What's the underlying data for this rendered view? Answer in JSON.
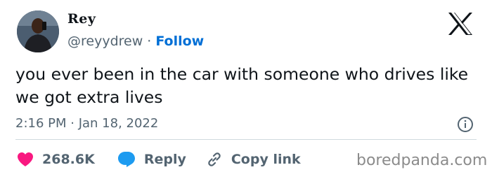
{
  "author": {
    "display_name": "Rey",
    "handle": "@reyydrew",
    "separator": "·",
    "follow_label": "Follow"
  },
  "tweet": {
    "text": "you ever been in the car with someone who drives like we got extra lives",
    "timestamp": "2:16 PM · Jan 18, 2022"
  },
  "actions": {
    "like_count": "268.6K",
    "reply_label": "Reply",
    "copy_label": "Copy link"
  },
  "watermark": "boredpanda.com",
  "colors": {
    "like": "#f91880",
    "reply": "#1d9bf0",
    "follow": "#006fd6",
    "muted": "#536471"
  },
  "icons": [
    "x-logo-icon",
    "info-icon",
    "heart-icon",
    "reply-bubble-icon",
    "link-icon"
  ]
}
